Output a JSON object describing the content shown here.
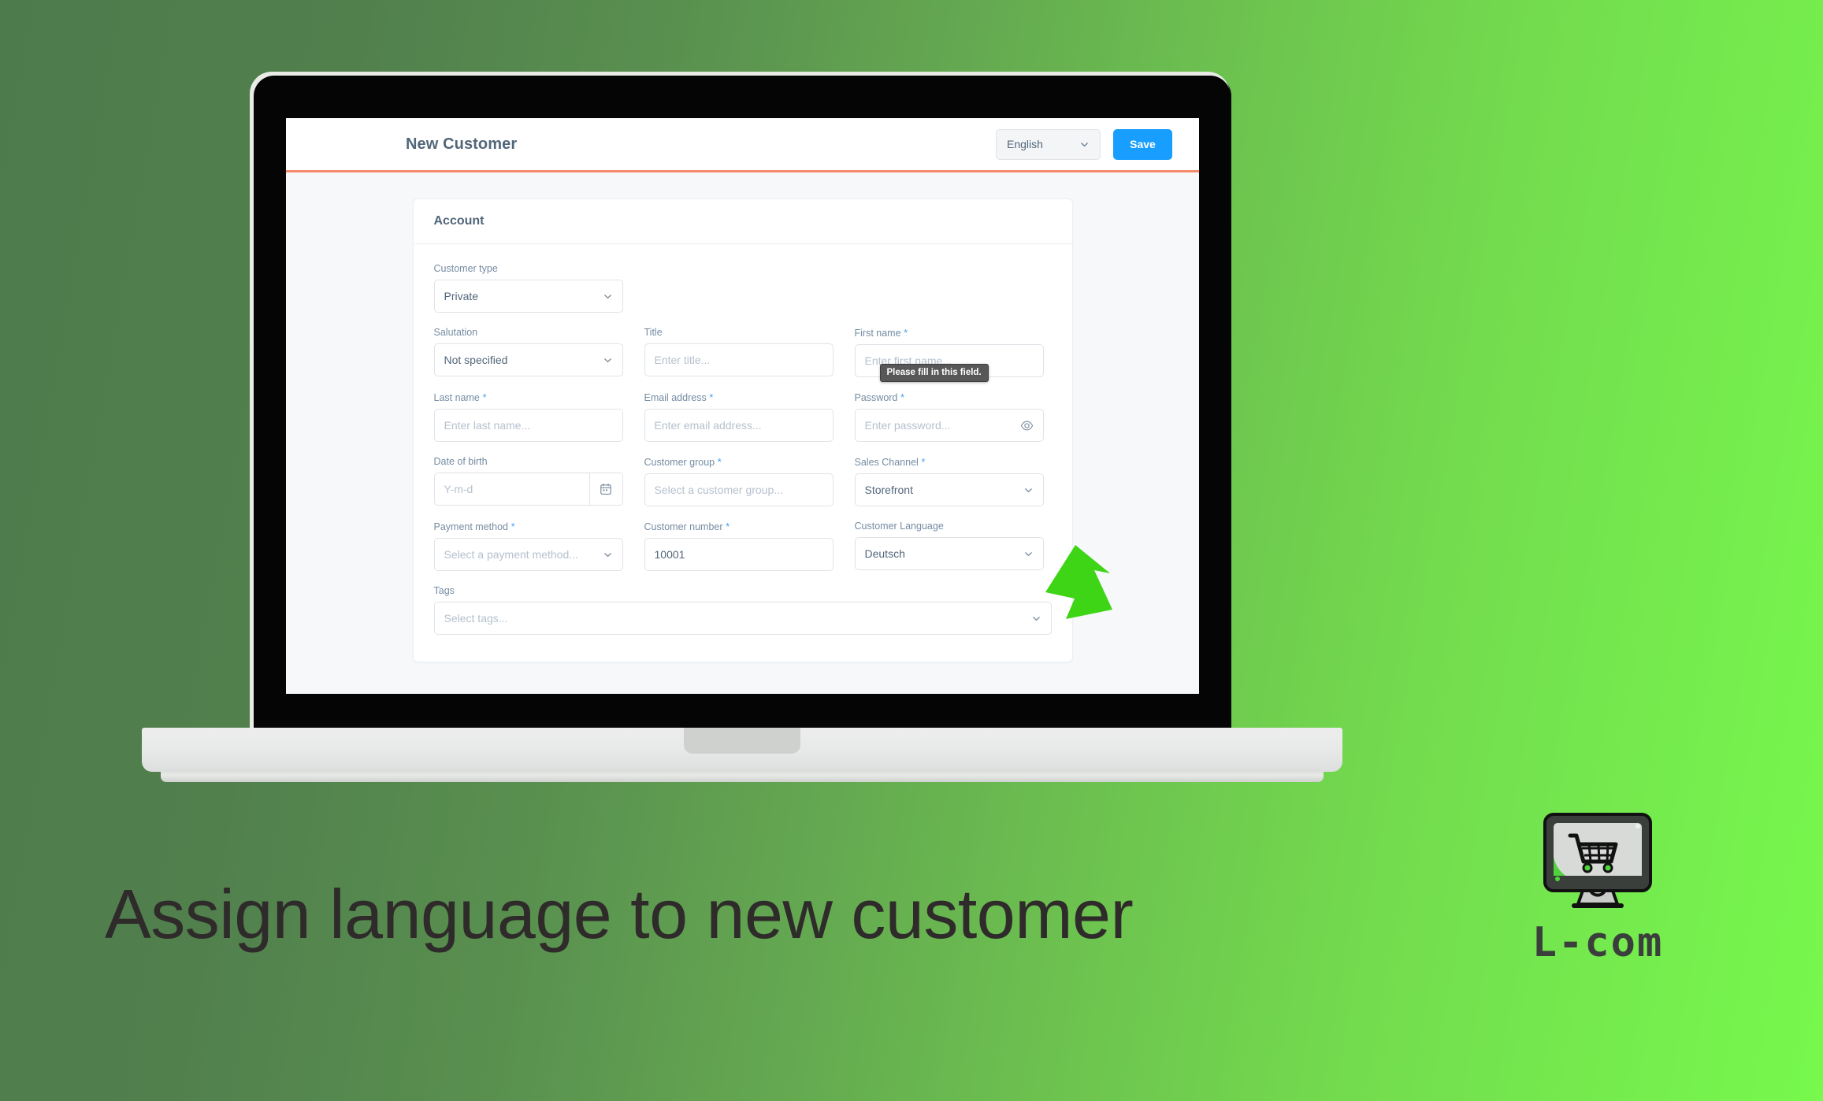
{
  "header": {
    "title": "New Customer",
    "language_value": "English",
    "save_label": "Save"
  },
  "card": {
    "title": "Account"
  },
  "form": {
    "rows": [
      {
        "fields": [
          {
            "label": "Customer type",
            "required": false,
            "type": "select",
            "value": "Private",
            "placeholder": ""
          }
        ]
      },
      {
        "fields": [
          {
            "label": "Salutation",
            "required": false,
            "type": "select",
            "value": "Not specified",
            "placeholder": ""
          },
          {
            "label": "Title",
            "required": false,
            "type": "text",
            "value": "",
            "placeholder": "Enter title..."
          },
          {
            "label": "First name",
            "required": true,
            "type": "text",
            "value": "",
            "placeholder": "Enter first name..."
          }
        ]
      },
      {
        "fields": [
          {
            "label": "Last name",
            "required": true,
            "type": "text",
            "value": "",
            "placeholder": "Enter last name..."
          },
          {
            "label": "Email address",
            "required": true,
            "type": "text",
            "value": "",
            "placeholder": "Enter email address..."
          },
          {
            "label": "Password",
            "required": true,
            "type": "password",
            "value": "",
            "placeholder": "Enter password..."
          }
        ]
      },
      {
        "fields": [
          {
            "label": "Date of birth",
            "required": false,
            "type": "date",
            "value": "",
            "placeholder": "Y-m-d"
          },
          {
            "label": "Customer group",
            "required": true,
            "type": "text",
            "value": "",
            "placeholder": "Select a customer group..."
          },
          {
            "label": "Sales Channel",
            "required": true,
            "type": "select",
            "value": "Storefront",
            "placeholder": ""
          }
        ]
      },
      {
        "fields": [
          {
            "label": "Payment method",
            "required": true,
            "type": "select",
            "value": "",
            "placeholder": "Select a payment method..."
          },
          {
            "label": "Customer number",
            "required": true,
            "type": "text",
            "value": "10001",
            "placeholder": ""
          },
          {
            "label": "Customer Language",
            "required": false,
            "type": "select",
            "value": "Deutsch",
            "placeholder": ""
          }
        ]
      },
      {
        "fields": [
          {
            "label": "Tags",
            "required": false,
            "type": "select",
            "value": "",
            "placeholder": "Select tags...",
            "full": true
          }
        ]
      }
    ]
  },
  "tooltip": {
    "text": "Please fill in this field."
  },
  "annotation": {
    "arrow_color": "#3ed516"
  },
  "caption": {
    "text": "Assign language to new customer"
  },
  "logo": {
    "text": "L-com",
    "icon": "monitor-cart-icon",
    "accent_color": "#4ed33c"
  }
}
